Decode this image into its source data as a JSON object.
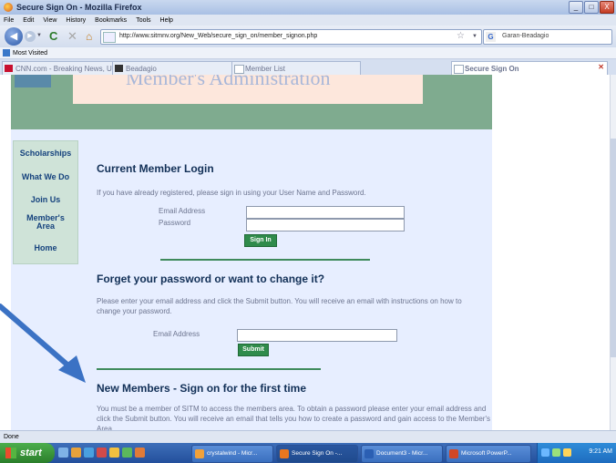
{
  "window": {
    "title": "Secure Sign On - Mozilla Firefox",
    "controls": {
      "minimize": "_",
      "maximize": "□",
      "close": "X"
    }
  },
  "menu": [
    "File",
    "Edit",
    "View",
    "History",
    "Bookmarks",
    "Tools",
    "Help"
  ],
  "nav": {
    "url": "http://www.sitmnv.org/New_Web/secure_sign_on/member_signon.php",
    "search_text": "Garan-Beadagio"
  },
  "bookmarks": {
    "most_visited": "Most Visited"
  },
  "tabs": [
    {
      "label": "CNN.com - Breaking News, U.S., World...",
      "icon": "cnn-icon",
      "active": false
    },
    {
      "label": "Beadagio",
      "icon": "beadagio-icon",
      "active": false
    },
    {
      "label": "Member List",
      "icon": "page-icon",
      "active": false
    },
    {
      "label": "Secure Sign On",
      "icon": "page-icon",
      "active": true
    }
  ],
  "site": {
    "banner_title": "Member's Administration",
    "sidebar": [
      "Scholarships",
      "What We Do",
      "Join Us",
      "Member's Area",
      "Home"
    ],
    "login": {
      "heading": "Current Member Login",
      "intro": "If you have already registered, please sign in using your User Name and Password.",
      "email_label": "Email Address",
      "password_label": "Password",
      "button": "Sign In"
    },
    "forgot": {
      "heading": "Forget your password or want to change it?",
      "intro": "Please enter your email address and click the Submit button. You will receive an email with instructions on how to change your password.",
      "email_label": "Email Address",
      "button": "Submit"
    },
    "new_members": {
      "heading": "New Members - Sign on for the first time",
      "intro": "You must be a member of SITM to access the members area. To obtain a password please enter your email address and click the Submit button. You will receive an email that tells you how to create a password and gain access to the Member's Area."
    }
  },
  "status": {
    "text": "Done"
  },
  "taskbar": {
    "start": "start",
    "tasks": [
      {
        "label": "crystalwind - Micr...",
        "color": "#f2a13a",
        "active": false
      },
      {
        "label": "Secure Sign On -...",
        "color": "#e9771e",
        "active": true
      },
      {
        "label": "Document3 - Micr...",
        "color": "#2b5fb3",
        "active": false
      },
      {
        "label": "Microsoft PowerP...",
        "color": "#d24726",
        "active": false
      }
    ],
    "clock": "9:21 AM"
  },
  "colors": {
    "banner_green": "#7fab8f",
    "page_bg": "#e7eeff",
    "heading": "#123057",
    "button_green": "#2f8b4b",
    "arrow_blue": "#3b72c4"
  }
}
